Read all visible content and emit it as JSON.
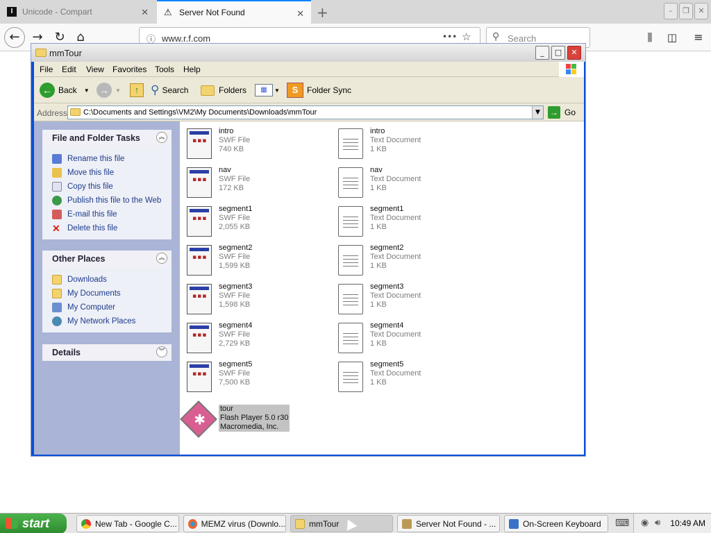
{
  "browser": {
    "tabs": [
      {
        "title": "Unicode - Compart",
        "active": false
      },
      {
        "title": "Server Not Found",
        "active": true
      }
    ],
    "url": "www.r.f.com",
    "url_more": "•••",
    "search_placeholder": "Search"
  },
  "explorer": {
    "title": "mmTour",
    "menu": [
      "File",
      "Edit",
      "View",
      "Favorites",
      "Tools",
      "Help"
    ],
    "toolbar": {
      "back": "Back",
      "search": "Search",
      "folders": "Folders",
      "folder_sync": "Folder Sync"
    },
    "address": {
      "label": "Address",
      "path": "C:\\Documents and Settings\\VM2\\My Documents\\Downloads\\mmTour",
      "go": "Go"
    },
    "tasks_panel": {
      "title": "File and Folder Tasks",
      "items": [
        "Rename this file",
        "Move this file",
        "Copy this file",
        "Publish this file to the Web",
        "E-mail this file",
        "Delete this file"
      ]
    },
    "places_panel": {
      "title": "Other Places",
      "items": [
        "Downloads",
        "My Documents",
        "My Computer",
        "My Network Places"
      ]
    },
    "details_panel": {
      "title": "Details"
    },
    "files": [
      {
        "name": "intro",
        "type": "SWF File",
        "size": "740 KB"
      },
      {
        "name": "intro",
        "type": "Text Document",
        "size": "1 KB"
      },
      {
        "name": "nav",
        "type": "SWF File",
        "size": "172 KB"
      },
      {
        "name": "nav",
        "type": "Text Document",
        "size": "1 KB"
      },
      {
        "name": "segment1",
        "type": "SWF File",
        "size": "2,055 KB"
      },
      {
        "name": "segment1",
        "type": "Text Document",
        "size": "1 KB"
      },
      {
        "name": "segment2",
        "type": "SWF File",
        "size": "1,599 KB"
      },
      {
        "name": "segment2",
        "type": "Text Document",
        "size": "1 KB"
      },
      {
        "name": "segment3",
        "type": "SWF File",
        "size": "1,598 KB"
      },
      {
        "name": "segment3",
        "type": "Text Document",
        "size": "1 KB"
      },
      {
        "name": "segment4",
        "type": "SWF File",
        "size": "2,729 KB"
      },
      {
        "name": "segment4",
        "type": "Text Document",
        "size": "1 KB"
      },
      {
        "name": "segment5",
        "type": "SWF File",
        "size": "7,500 KB"
      },
      {
        "name": "segment5",
        "type": "Text Document",
        "size": "1 KB"
      }
    ],
    "selected_file": {
      "name": "tour",
      "line2": "Flash Player 5.0 r30",
      "line3": "Macromedia, Inc."
    }
  },
  "taskbar": {
    "start_label": "start",
    "buttons": [
      "New Tab - Google C...",
      "MEMZ virus (Downlo...",
      "mmTour",
      "Server Not Found - ...",
      "On-Screen Keyboard"
    ],
    "clock": "10:49 AM"
  }
}
